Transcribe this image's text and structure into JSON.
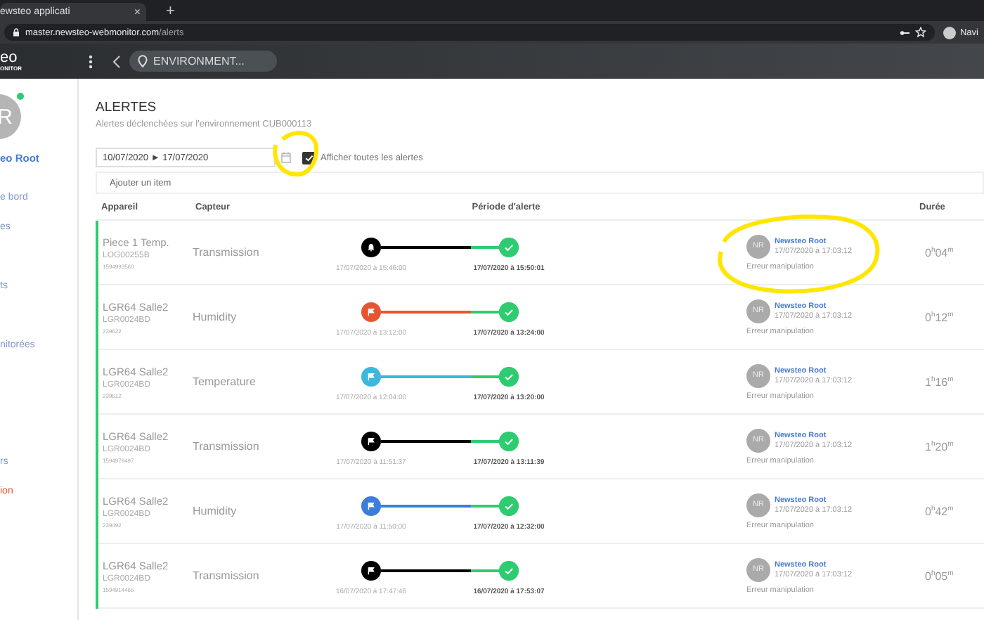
{
  "browser": {
    "tab_title": "ewsteo applicati",
    "tab_close": "×",
    "new_tab": "+",
    "url_host": "master.newsteo-webmonitor.com",
    "url_path": "/alerts",
    "profile_label": "Navi"
  },
  "app_header": {
    "logo_top": "eo",
    "logo_bottom": "ONITOR",
    "location": "ENVIRONMENT..."
  },
  "sidebar": {
    "avatar_text": "R",
    "online": true,
    "user_name": "eo Root",
    "items": [
      {
        "label": "e bord",
        "selected": false
      },
      {
        "label": "es",
        "selected": false
      },
      {
        "label": "ts",
        "selected": false
      },
      {
        "label": "nitorées",
        "selected": false
      },
      {
        "label": "rs",
        "selected": false
      },
      {
        "label": "ion",
        "selected": true
      }
    ]
  },
  "page": {
    "title": "ALERTES",
    "subtitle": "Alertes déclenchées sur l'environnement CUB000113"
  },
  "filters": {
    "date_range": "10/07/2020 ► 17/07/2020",
    "show_all": {
      "label": "Afficher toutes les alertes",
      "checked": true
    },
    "add_item": {
      "placeholder": "Ajouter un item"
    }
  },
  "table": {
    "columns": [
      "Appareil",
      "Capteur",
      "Période d'alerte",
      "Durée"
    ],
    "rows": [
      {
        "device": "Piece 1 Temp.",
        "device_id": "LOG00255B",
        "serial": "1594993560",
        "sensor": "Transmission",
        "kind": "bell",
        "color": "#000000",
        "start": "17/07/2020 à 15:46:00",
        "end": "17/07/2020 à 15:50:01",
        "user_initials": "NR",
        "user_name": "Newsteo Root",
        "user_date": "17/07/2020 à 17:03:12",
        "note": "Erreur manipulation",
        "duration": "0$^{h}$04$^{m}$"
      },
      {
        "device": "LGR64 Salle2",
        "device_id": "LGR0024BD",
        "serial": "239622",
        "sensor": "Humidity",
        "kind": "flag",
        "color": "#e8542f",
        "start": "17/07/2020 à 13:12:00",
        "end": "17/07/2020 à 13:24:00",
        "user_initials": "NR",
        "user_name": "Newsteo Root",
        "user_date": "17/07/2020 à 17:03:12",
        "note": "Erreur manipulation",
        "duration": "0$^{h}$12$^{m}$"
      },
      {
        "device": "LGR64 Salle2",
        "device_id": "LGR0024BD",
        "serial": "239612",
        "sensor": "Temperature",
        "kind": "flag",
        "color": "#3bb8dc",
        "start": "17/07/2020 à 12:04:00",
        "end": "17/07/2020 à 13:20:00",
        "user_initials": "NR",
        "user_name": "Newsteo Root",
        "user_date": "17/07/2020 à 17:03:12",
        "note": "Erreur manipulation",
        "duration": "1$^{h}$16$^{m}$"
      },
      {
        "device": "LGR64 Salle2",
        "device_id": "LGR0024BD",
        "serial": "1594979497",
        "sensor": "Transmission",
        "kind": "flag",
        "color": "#000000",
        "start": "17/07/2020 à 11:51:37",
        "end": "17/07/2020 à 13:11:39",
        "user_initials": "NR",
        "user_name": "Newsteo Root",
        "user_date": "17/07/2020 à 17:03:12",
        "note": "Erreur manipulation",
        "duration": "1$^{h}$20$^{m}$"
      },
      {
        "device": "LGR64 Salle2",
        "device_id": "LGR0024BD",
        "serial": "239492",
        "sensor": "Humidity",
        "kind": "flag",
        "color": "#3b7dd8",
        "start": "17/07/2020 à 11:50:00",
        "end": "17/07/2020 à 12:32:00",
        "user_initials": "NR",
        "user_name": "Newsteo Root",
        "user_date": "17/07/2020 à 17:03:12",
        "note": "Erreur manipulation",
        "duration": "0$^{h}$42$^{m}$"
      },
      {
        "device": "LGR64 Salle2",
        "device_id": "LGR0024BD",
        "serial": "1594914466",
        "sensor": "Transmission",
        "kind": "flag",
        "color": "#000000",
        "start": "16/07/2020 à 17:47:46",
        "end": "16/07/2020 à 17:53:07",
        "user_initials": "NR",
        "user_name": "Newsteo Root",
        "user_date": "17/07/2020 à 17:03:12",
        "note": "Erreur manipulation",
        "duration": "0$^{h}$05$^{m}$"
      }
    ]
  }
}
